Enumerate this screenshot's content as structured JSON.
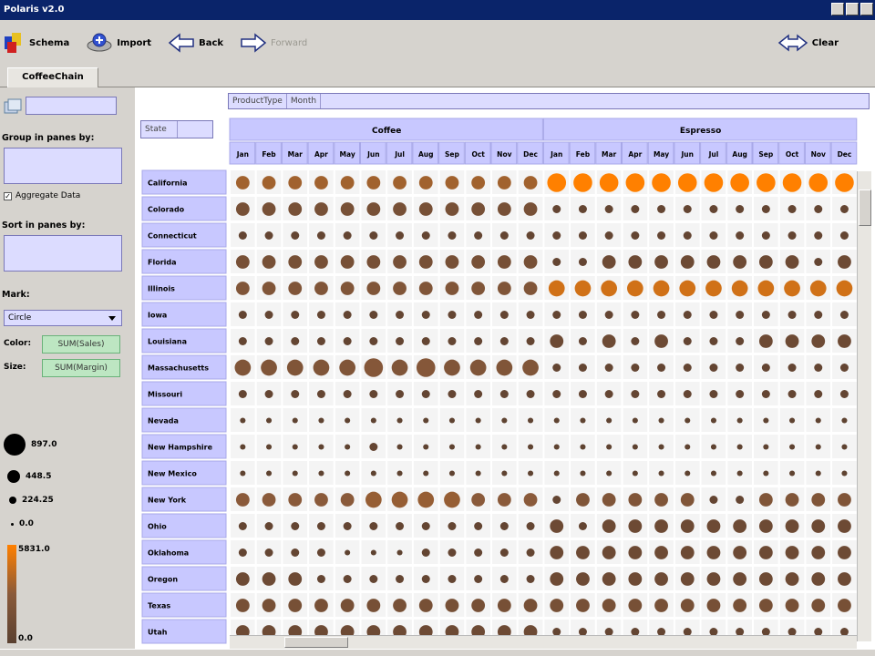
{
  "window": {
    "title": "Polaris v2.0"
  },
  "toolbar": {
    "schema_label": "Schema",
    "import_label": "Import",
    "back_label": "Back",
    "forward_label": "Forward",
    "clear_label": "Clear"
  },
  "tabs": [
    {
      "label": "CoffeeChain"
    }
  ],
  "sidebar": {
    "group_label": "Group in panes by:",
    "aggregate_label": "Aggregate Data",
    "sort_label": "Sort in panes by:",
    "mark_label": "Mark:",
    "mark_value": "Circle",
    "color_label": "Color:",
    "color_field": "SUM(Sales)",
    "size_label": "Size:",
    "size_field": "SUM(Margin)",
    "size_legend": [
      "897.0",
      "448.5",
      "224.25",
      "0.0"
    ],
    "color_legend": [
      "5831.0",
      "0.0"
    ]
  },
  "shelves": {
    "filters": [
      "ProductType",
      "Month"
    ],
    "rows": [
      "State"
    ]
  },
  "chart_data": {
    "type": "scatter",
    "mark": "circle",
    "color_encoding": "SUM(Sales)",
    "size_encoding": "SUM(Margin)",
    "column_groups": [
      "Coffee",
      "Espresso"
    ],
    "months": [
      "Jan",
      "Feb",
      "Mar",
      "Apr",
      "May",
      "Jun",
      "Jul",
      "Aug",
      "Sep",
      "Oct",
      "Nov",
      "Dec"
    ],
    "states": [
      "California",
      "Colorado",
      "Connecticut",
      "Florida",
      "Illinois",
      "Iowa",
      "Louisiana",
      "Massachusetts",
      "Missouri",
      "Nevada",
      "New Hampshire",
      "New Mexico",
      "New York",
      "Ohio",
      "Oklahoma",
      "Oregon",
      "Texas",
      "Utah"
    ],
    "size_range": [
      0,
      897
    ],
    "color_range": [
      0,
      5831
    ],
    "color_scale": [
      "#5a4030",
      "#8a5a3a",
      "#ff8000"
    ],
    "rows": [
      {
        "state": "California",
        "sizes": [
          [
            4,
            4,
            4,
            4,
            4,
            4,
            4,
            4,
            4,
            4,
            4,
            4
          ],
          [
            6,
            6,
            6,
            6,
            6,
            6,
            6,
            6,
            6,
            6,
            6,
            6
          ]
        ],
        "colors": [
          [
            0.6,
            0.6,
            0.6,
            0.6,
            0.6,
            0.6,
            0.6,
            0.6,
            0.6,
            0.6,
            0.6,
            0.6
          ],
          [
            1,
            1,
            1,
            1,
            1,
            1,
            1,
            1,
            1,
            1,
            1,
            1
          ]
        ]
      },
      {
        "state": "Colorado",
        "sizes": [
          [
            4,
            4,
            4,
            4,
            4,
            4,
            4,
            4,
            4,
            4,
            4,
            4
          ],
          [
            2,
            2,
            2,
            2,
            2,
            2,
            2,
            2,
            2,
            2,
            2,
            2
          ]
        ],
        "colors": [
          [
            0.3,
            0.3,
            0.3,
            0.3,
            0.3,
            0.3,
            0.3,
            0.3,
            0.3,
            0.3,
            0.3,
            0.3
          ],
          [
            0.1,
            0.1,
            0.1,
            0.1,
            0.1,
            0.1,
            0.1,
            0.1,
            0.1,
            0.1,
            0.1,
            0.1
          ]
        ]
      },
      {
        "state": "Connecticut",
        "sizes": [
          [
            2,
            2,
            2,
            2,
            2,
            2,
            2,
            2,
            2,
            2,
            2,
            2
          ],
          [
            2,
            2,
            2,
            2,
            2,
            2,
            2,
            2,
            2,
            2,
            2,
            2
          ]
        ],
        "colors": [
          [
            0.1,
            0.1,
            0.1,
            0.1,
            0.1,
            0.1,
            0.1,
            0.1,
            0.1,
            0.1,
            0.1,
            0.1
          ],
          [
            0.1,
            0.1,
            0.1,
            0.1,
            0.1,
            0.1,
            0.1,
            0.1,
            0.1,
            0.1,
            0.1,
            0.1
          ]
        ]
      },
      {
        "state": "Florida",
        "sizes": [
          [
            4,
            4,
            4,
            4,
            4,
            4,
            4,
            4,
            4,
            4,
            4,
            4
          ],
          [
            2,
            2,
            4,
            4,
            4,
            4,
            4,
            4,
            4,
            4,
            2,
            4
          ]
        ],
        "colors": [
          [
            0.3,
            0.3,
            0.3,
            0.3,
            0.3,
            0.3,
            0.3,
            0.3,
            0.3,
            0.3,
            0.3,
            0.3
          ],
          [
            0.1,
            0.1,
            0.2,
            0.2,
            0.2,
            0.2,
            0.2,
            0.2,
            0.2,
            0.2,
            0.1,
            0.2
          ]
        ]
      },
      {
        "state": "Illinois",
        "sizes": [
          [
            4,
            4,
            4,
            4,
            4,
            4,
            4,
            4,
            4,
            4,
            4,
            4
          ],
          [
            5,
            5,
            5,
            5,
            5,
            5,
            5,
            5,
            5,
            5,
            5,
            5
          ]
        ],
        "colors": [
          [
            0.4,
            0.4,
            0.4,
            0.4,
            0.4,
            0.4,
            0.4,
            0.4,
            0.4,
            0.4,
            0.4,
            0.4
          ],
          [
            0.8,
            0.8,
            0.8,
            0.8,
            0.8,
            0.8,
            0.8,
            0.8,
            0.8,
            0.8,
            0.8,
            0.8
          ]
        ]
      },
      {
        "state": "Iowa",
        "sizes": [
          [
            2,
            2,
            2,
            2,
            2,
            2,
            2,
            2,
            2,
            2,
            2,
            2
          ],
          [
            2,
            2,
            2,
            2,
            2,
            2,
            2,
            2,
            2,
            2,
            2,
            2
          ]
        ],
        "colors": [
          [
            0.1,
            0.1,
            0.1,
            0.1,
            0.1,
            0.1,
            0.1,
            0.1,
            0.1,
            0.1,
            0.1,
            0.1
          ],
          [
            0.1,
            0.1,
            0.1,
            0.1,
            0.1,
            0.1,
            0.1,
            0.1,
            0.1,
            0.1,
            0.1,
            0.1
          ]
        ]
      },
      {
        "state": "Louisiana",
        "sizes": [
          [
            2,
            2,
            2,
            2,
            2,
            2,
            2,
            2,
            2,
            2,
            2,
            2
          ],
          [
            4,
            2,
            4,
            2,
            4,
            2,
            2,
            2,
            4,
            4,
            4,
            4
          ]
        ],
        "colors": [
          [
            0.1,
            0.1,
            0.1,
            0.1,
            0.1,
            0.1,
            0.1,
            0.1,
            0.1,
            0.1,
            0.1,
            0.1
          ],
          [
            0.2,
            0.1,
            0.2,
            0.1,
            0.2,
            0.1,
            0.1,
            0.1,
            0.2,
            0.2,
            0.2,
            0.2
          ]
        ]
      },
      {
        "state": "Massachusetts",
        "sizes": [
          [
            5,
            5,
            5,
            5,
            5,
            6,
            5,
            6,
            5,
            5,
            5,
            5
          ],
          [
            2,
            2,
            2,
            2,
            2,
            2,
            2,
            2,
            2,
            2,
            2,
            2
          ]
        ],
        "colors": [
          [
            0.4,
            0.4,
            0.4,
            0.4,
            0.4,
            0.45,
            0.4,
            0.45,
            0.4,
            0.4,
            0.4,
            0.4
          ],
          [
            0.1,
            0.1,
            0.1,
            0.1,
            0.1,
            0.1,
            0.1,
            0.1,
            0.1,
            0.1,
            0.1,
            0.1
          ]
        ]
      },
      {
        "state": "Missouri",
        "sizes": [
          [
            2,
            2,
            2,
            2,
            2,
            2,
            2,
            2,
            2,
            2,
            2,
            2
          ],
          [
            2,
            2,
            2,
            2,
            2,
            2,
            2,
            2,
            2,
            2,
            2,
            2
          ]
        ],
        "colors": [
          [
            0.1,
            0.1,
            0.1,
            0.1,
            0.1,
            0.1,
            0.1,
            0.1,
            0.1,
            0.1,
            0.1,
            0.1
          ],
          [
            0.1,
            0.1,
            0.1,
            0.1,
            0.1,
            0.1,
            0.1,
            0.1,
            0.1,
            0.1,
            0.1,
            0.1
          ]
        ]
      },
      {
        "state": "Nevada",
        "sizes": [
          [
            1,
            1,
            1,
            1,
            1,
            1,
            1,
            1,
            1,
            1,
            1,
            1
          ],
          [
            1,
            1,
            1,
            1,
            1,
            1,
            1,
            1,
            1,
            1,
            1,
            1
          ]
        ],
        "colors": [
          [
            0.05,
            0.05,
            0.05,
            0.05,
            0.05,
            0.05,
            0.05,
            0.05,
            0.05,
            0.05,
            0.05,
            0.05
          ],
          [
            0.05,
            0.05,
            0.05,
            0.05,
            0.05,
            0.05,
            0.05,
            0.05,
            0.05,
            0.05,
            0.05,
            0.05
          ]
        ]
      },
      {
        "state": "New Hampshire",
        "sizes": [
          [
            1,
            1,
            1,
            1,
            1,
            2,
            1,
            1,
            1,
            1,
            1,
            1
          ],
          [
            1,
            1,
            1,
            1,
            1,
            1,
            1,
            1,
            1,
            1,
            1,
            1
          ]
        ],
        "colors": [
          [
            0.05,
            0.05,
            0.05,
            0.05,
            0.05,
            0.1,
            0.05,
            0.05,
            0.05,
            0.05,
            0.05,
            0.05
          ],
          [
            0.05,
            0.05,
            0.05,
            0.05,
            0.05,
            0.05,
            0.05,
            0.05,
            0.05,
            0.05,
            0.05,
            0.05
          ]
        ]
      },
      {
        "state": "New Mexico",
        "sizes": [
          [
            1,
            1,
            1,
            1,
            1,
            1,
            1,
            1,
            1,
            1,
            1,
            1
          ],
          [
            1,
            1,
            1,
            1,
            1,
            1,
            1,
            1,
            1,
            1,
            1,
            1
          ]
        ],
        "colors": [
          [
            0.05,
            0.05,
            0.05,
            0.05,
            0.05,
            0.05,
            0.05,
            0.05,
            0.05,
            0.05,
            0.05,
            0.05
          ],
          [
            0.05,
            0.05,
            0.05,
            0.05,
            0.05,
            0.05,
            0.05,
            0.05,
            0.05,
            0.05,
            0.05,
            0.05
          ]
        ]
      },
      {
        "state": "New York",
        "sizes": [
          [
            4,
            4,
            4,
            4,
            4,
            5,
            5,
            5,
            5,
            4,
            4,
            4
          ],
          [
            2,
            4,
            4,
            4,
            4,
            4,
            2,
            2,
            4,
            4,
            4,
            4
          ]
        ],
        "colors": [
          [
            0.5,
            0.5,
            0.5,
            0.5,
            0.5,
            0.55,
            0.55,
            0.55,
            0.55,
            0.5,
            0.5,
            0.5
          ],
          [
            0.1,
            0.4,
            0.4,
            0.4,
            0.4,
            0.4,
            0.1,
            0.1,
            0.4,
            0.4,
            0.4,
            0.4
          ]
        ]
      },
      {
        "state": "Ohio",
        "sizes": [
          [
            2,
            2,
            2,
            2,
            2,
            2,
            2,
            2,
            2,
            2,
            2,
            2
          ],
          [
            4,
            2,
            4,
            4,
            4,
            4,
            4,
            4,
            4,
            4,
            4,
            4
          ]
        ],
        "colors": [
          [
            0.1,
            0.1,
            0.1,
            0.1,
            0.1,
            0.1,
            0.1,
            0.1,
            0.1,
            0.1,
            0.1,
            0.1
          ],
          [
            0.2,
            0.1,
            0.2,
            0.2,
            0.2,
            0.2,
            0.2,
            0.2,
            0.2,
            0.2,
            0.2,
            0.2
          ]
        ]
      },
      {
        "state": "Oklahoma",
        "sizes": [
          [
            2,
            2,
            2,
            2,
            1,
            1,
            1,
            2,
            2,
            2,
            2,
            2
          ],
          [
            4,
            4,
            4,
            4,
            4,
            4,
            4,
            4,
            4,
            4,
            4,
            4
          ]
        ],
        "colors": [
          [
            0.1,
            0.1,
            0.1,
            0.1,
            0.05,
            0.05,
            0.05,
            0.1,
            0.1,
            0.1,
            0.1,
            0.1
          ],
          [
            0.2,
            0.2,
            0.2,
            0.2,
            0.2,
            0.2,
            0.2,
            0.2,
            0.2,
            0.2,
            0.2,
            0.2
          ]
        ]
      },
      {
        "state": "Oregon",
        "sizes": [
          [
            4,
            4,
            4,
            2,
            2,
            2,
            2,
            2,
            2,
            2,
            2,
            2
          ],
          [
            4,
            4,
            4,
            4,
            4,
            4,
            4,
            4,
            4,
            4,
            4,
            4
          ]
        ],
        "colors": [
          [
            0.2,
            0.2,
            0.2,
            0.1,
            0.1,
            0.1,
            0.1,
            0.1,
            0.1,
            0.1,
            0.1,
            0.1
          ],
          [
            0.2,
            0.2,
            0.2,
            0.2,
            0.2,
            0.2,
            0.2,
            0.2,
            0.2,
            0.2,
            0.2,
            0.2
          ]
        ]
      },
      {
        "state": "Texas",
        "sizes": [
          [
            4,
            4,
            4,
            4,
            4,
            4,
            4,
            4,
            4,
            4,
            4,
            4
          ],
          [
            4,
            4,
            4,
            4,
            4,
            4,
            4,
            4,
            4,
            4,
            4,
            4
          ]
        ],
        "colors": [
          [
            0.3,
            0.3,
            0.3,
            0.3,
            0.3,
            0.3,
            0.3,
            0.3,
            0.3,
            0.3,
            0.3,
            0.3
          ],
          [
            0.3,
            0.3,
            0.3,
            0.3,
            0.3,
            0.3,
            0.3,
            0.3,
            0.3,
            0.3,
            0.3,
            0.3
          ]
        ]
      },
      {
        "state": "Utah",
        "sizes": [
          [
            4,
            4,
            4,
            4,
            4,
            4,
            4,
            4,
            4,
            4,
            4,
            4
          ],
          [
            2,
            2,
            2,
            2,
            2,
            2,
            2,
            2,
            2,
            2,
            2,
            2
          ]
        ],
        "colors": [
          [
            0.2,
            0.2,
            0.2,
            0.2,
            0.2,
            0.2,
            0.2,
            0.2,
            0.2,
            0.2,
            0.2,
            0.2
          ],
          [
            0.1,
            0.1,
            0.1,
            0.1,
            0.1,
            0.1,
            0.1,
            0.1,
            0.1,
            0.1,
            0.1,
            0.1
          ]
        ]
      }
    ]
  }
}
